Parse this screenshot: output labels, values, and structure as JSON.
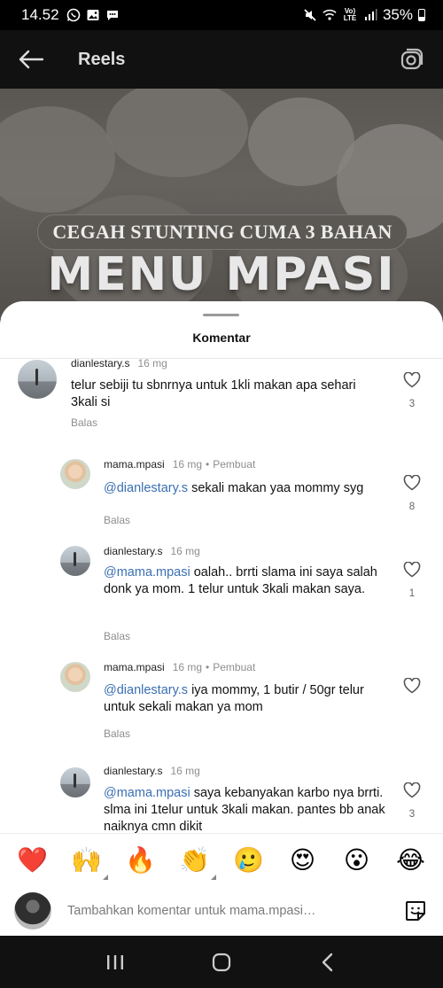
{
  "status_bar": {
    "time": "14.52",
    "battery": "35%",
    "icons": [
      "whatsapp-icon",
      "gallery-icon",
      "chat-icon",
      "mute-icon",
      "wifi-icon",
      "volte-icon",
      "signal-icon",
      "battery-icon"
    ],
    "volte_label": "Vo) LTE"
  },
  "header": {
    "title": "Reels"
  },
  "video": {
    "banner": "CEGAH STUNTING CUMA 3 BAHAN",
    "headline": "MENU MPASI"
  },
  "sheet": {
    "title": "Komentar"
  },
  "comments": [
    {
      "user": "dianlestary.s",
      "time": "16 mg",
      "creator": "",
      "mention": "",
      "text": "telur sebiji tu sbnrnya untuk 1kli makan apa sehari 3kali si",
      "reply": "Balas",
      "likes": "3"
    },
    {
      "user": "mama.mpasi",
      "time": "16 mg",
      "creator": "Pembuat",
      "mention": "@dianlestary.s",
      "text": " sekali makan yaa mommy syg",
      "reply": "Balas",
      "likes": "8"
    },
    {
      "user": "dianlestary.s",
      "time": "16 mg",
      "creator": "",
      "mention": "@mama.mpasi",
      "text": " oalah.. brrti slama ini saya salah donk ya mom. 1 telur untuk 3kali makan saya.",
      "reply": "Balas",
      "likes": "1"
    },
    {
      "user": "mama.mpasi",
      "time": "16 mg",
      "creator": "Pembuat",
      "mention": "@dianlestary.s",
      "text": " iya mommy, 1 butir / 50gr telur untuk sekali makan ya mom",
      "reply": "Balas",
      "likes": ""
    },
    {
      "user": "dianlestary.s",
      "time": "16 mg",
      "creator": "",
      "mention": "@mama.mpasi",
      "text": " saya kebanyakan karbo nya brrti. slma ini 1telur untuk 3kali makan. pantes bb anak naiknya cmn dikit",
      "reply": "",
      "likes": "3"
    }
  ],
  "emoji_bar": [
    "❤️",
    "🙌",
    "🔥",
    "👏",
    "🥲",
    "😍",
    "😮",
    "😂"
  ],
  "input": {
    "placeholder": "Tambahkan komentar untuk mama.mpasi…"
  },
  "nav": [
    "recent-apps",
    "home",
    "back"
  ],
  "colors": {
    "mention": "#3a6fb3",
    "heart_emoji": "#e8334f",
    "sheet_bg": "#ffffff"
  }
}
